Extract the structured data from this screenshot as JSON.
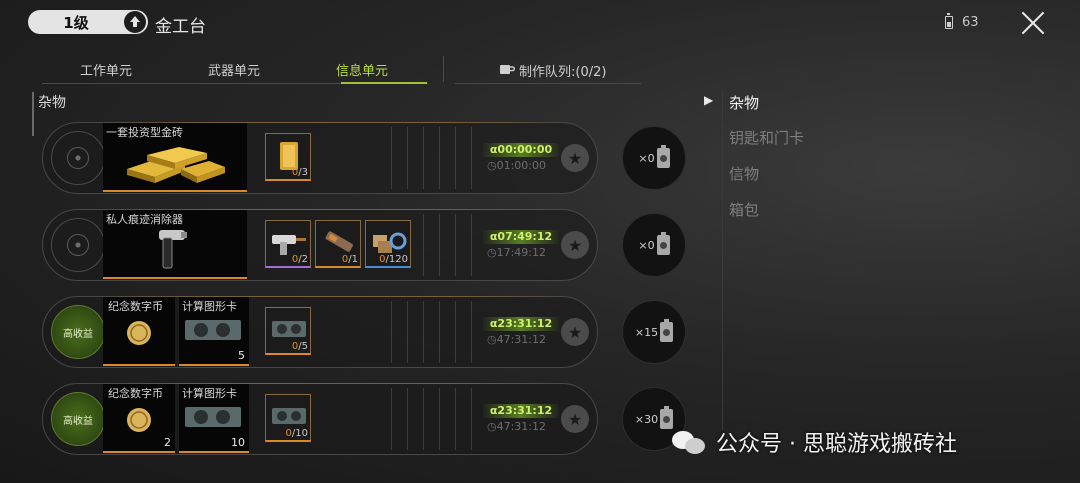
{
  "header": {
    "level": "1级",
    "title": "金工台",
    "energy": "63"
  },
  "tabs": [
    {
      "label": "工作单元",
      "active": false
    },
    {
      "label": "武器单元",
      "active": false
    },
    {
      "label": "信息单元",
      "active": true
    }
  ],
  "queue": {
    "label": "制作队列:(0/2)"
  },
  "category": "杂物",
  "recipes": [
    {
      "products": [
        {
          "name": "一套投资型金砖",
          "qty": ""
        }
      ],
      "materials": [
        {
          "have": "0",
          "need": "/3",
          "rarity": "gold"
        }
      ],
      "timer": "α00:00:00",
      "timer_sub": "◷01:00:00",
      "left_btn": "",
      "side_count": "×0"
    },
    {
      "products": [
        {
          "name": "私人痕迹消除器",
          "qty": ""
        }
      ],
      "materials": [
        {
          "have": "0",
          "need": "/2",
          "rarity": "purple"
        },
        {
          "have": "0",
          "need": "/1",
          "rarity": "gold"
        },
        {
          "have": "0",
          "need": "/120",
          "rarity": "blue"
        }
      ],
      "timer": "α07:49:12",
      "timer_sub": "◷17:49:12",
      "left_btn": "",
      "side_count": "×0"
    },
    {
      "products": [
        {
          "name": "纪念数字币",
          "qty": ""
        },
        {
          "name": "计算图形卡",
          "qty": "5"
        }
      ],
      "materials": [
        {
          "have": "0",
          "need": "/5",
          "rarity": "gold"
        }
      ],
      "timer": "α23:31:12",
      "timer_sub": "◷47:31:12",
      "left_btn": "高收益",
      "side_count": "×15"
    },
    {
      "products": [
        {
          "name": "纪念数字币",
          "qty": "2"
        },
        {
          "name": "计算图形卡",
          "qty": "10"
        }
      ],
      "materials": [
        {
          "have": "0",
          "need": "/10",
          "rarity": "gold"
        }
      ],
      "timer": "α23:31:12",
      "timer_sub": "◷47:31:12",
      "left_btn": "高收益",
      "side_count": "×30"
    }
  ],
  "sidebar": {
    "items": [
      {
        "label": "杂物",
        "active": true
      },
      {
        "label": "钥匙和门卡",
        "active": false
      },
      {
        "label": "信物",
        "active": false
      },
      {
        "label": "箱包",
        "active": false
      }
    ]
  },
  "watermark": "公众号 · 思聪游戏搬砖社",
  "colors": {
    "accent": "#b8dd40",
    "rarity_gold": "#d88a2a",
    "rarity_purple": "#a46bd6",
    "rarity_blue": "#4a8ad0"
  },
  "icons": [
    "level-up-icon",
    "battery-icon",
    "close-icon",
    "cup-icon",
    "star-icon",
    "wechat-icon"
  ]
}
